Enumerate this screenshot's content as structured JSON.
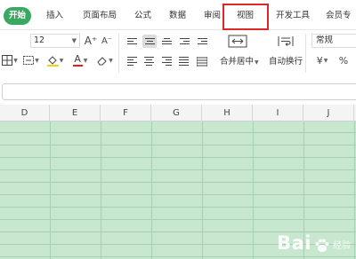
{
  "ribbon": {
    "tabs": [
      {
        "label": "开始",
        "active": true
      },
      {
        "label": "插入"
      },
      {
        "label": "页面布局"
      },
      {
        "label": "公式"
      },
      {
        "label": "数据"
      },
      {
        "label": "审阅"
      },
      {
        "label": "视图",
        "highlighted": true
      },
      {
        "label": "开发工具"
      },
      {
        "label": "会员专"
      }
    ]
  },
  "toolbar": {
    "font_size": "12",
    "grow_font": "A⁺",
    "shrink_font": "A⁻",
    "font_color_letter": "A",
    "merge_label": "合并居中",
    "wrap_label": "自动换行",
    "number_format": "常规",
    "currency_symbol": "¥",
    "percent_symbol": "%"
  },
  "sheet": {
    "columns": [
      "D",
      "E",
      "F",
      "G",
      "H",
      "I",
      "J"
    ]
  },
  "colors": {
    "accent_green": "#3aa861",
    "highlight_red": "#e0282b",
    "font_color_red": "#e02020",
    "fill_yellow": "#f4d300",
    "eye_protection_green": "#c7e7cf"
  },
  "watermark": {
    "text": "Bai",
    "suffix": "经验"
  }
}
